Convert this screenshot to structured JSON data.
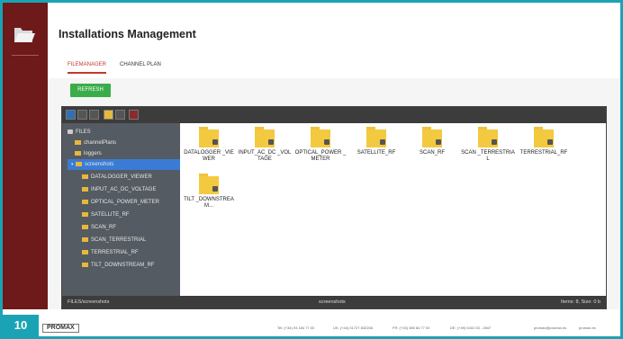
{
  "app": {
    "title": "Installations Management",
    "icon": "folder-open-icon"
  },
  "tabs": [
    {
      "label": "FILEMANAGER",
      "active": true
    },
    {
      "label": "CHANNEL PLAN",
      "active": false
    }
  ],
  "refresh_label": "REFRESH",
  "toolbar_icons": [
    "arrow-left-icon",
    "arrow-up-icon",
    "new-file-icon",
    "folder-icon",
    "grid-view-icon",
    "delete-icon"
  ],
  "tree": [
    {
      "label": "FILES",
      "type": "root"
    },
    {
      "label": "channelPlans",
      "type": "folder"
    },
    {
      "label": "loggers",
      "type": "folder"
    },
    {
      "label": "screenshots",
      "type": "folder",
      "selected": true
    },
    {
      "label": "DATALOGGER_VIEWER",
      "type": "folder"
    },
    {
      "label": "INPUT_AC_DC_VOLTAGE",
      "type": "folder"
    },
    {
      "label": "OPTICAL_POWER_METER",
      "type": "folder"
    },
    {
      "label": "SATELLITE_RF",
      "type": "folder"
    },
    {
      "label": "SCAN_RF",
      "type": "folder"
    },
    {
      "label": "SCAN_TERRESTRIAL",
      "type": "folder"
    },
    {
      "label": "TERRESTRIAL_RF",
      "type": "folder"
    },
    {
      "label": "TILT_DOWNSTREAM_RF",
      "type": "folder"
    }
  ],
  "folders": [
    {
      "label": "DATALOGGER _VIEWER"
    },
    {
      "label": "INPUT_AC_DC _VOLTAGE"
    },
    {
      "label": "OPTICAL_POWER _METER"
    },
    {
      "label": "SATELLITE_RF"
    },
    {
      "label": "SCAN_RF"
    },
    {
      "label": "SCAN _TERRESTRIAL"
    },
    {
      "label": "TERRESTRIAL_RF"
    },
    {
      "label": "TILT _DOWNSTREAM..."
    }
  ],
  "status": {
    "path": "FILES/screenshots",
    "center": "screenshots",
    "right": "Items: 8, Size: 0 b"
  },
  "footer": {
    "page_number": "10",
    "brand": "PROMAX",
    "contacts": [
      "Tel: (+34) 93 184 77 00",
      "UK: (+44) 01727 832266",
      "FR: (+33) 380 84 77 00",
      "DE: (+49) 6431 53 - 2847",
      "promax@promax.es",
      "promax.es"
    ]
  },
  "colors": {
    "accent": "#1aa3b5",
    "sidebar": "#6e1a1a",
    "active_tab": "#c0392b",
    "refresh": "#3aad4a",
    "folder": "#f3c93f",
    "selected": "#3a7bd5"
  }
}
